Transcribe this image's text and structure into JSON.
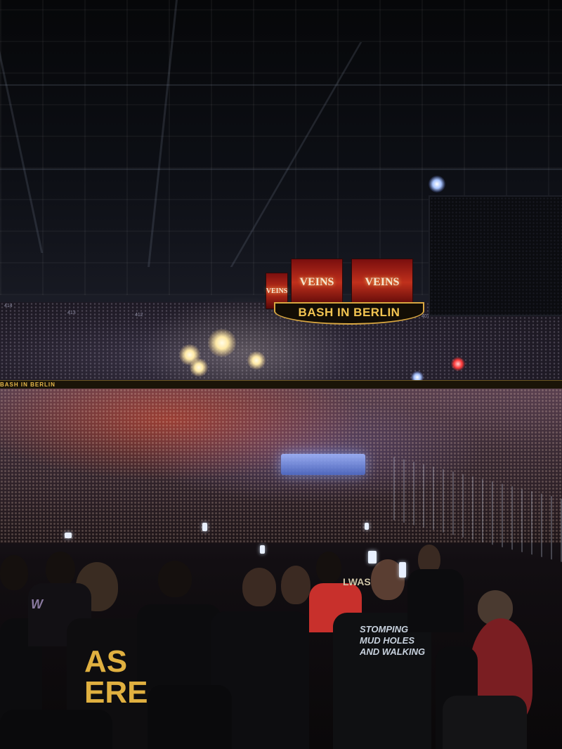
{
  "scene": {
    "description_colors": {
      "arena_dark": "#07070a",
      "stage_gold": "#f2c451",
      "crowd_red": "#dc4628",
      "screen_red": "#c0301c"
    },
    "jumbotron": {
      "screen_left": "VEINS",
      "screen_middle": "VEINS",
      "screen_right": "VEINS",
      "ring_text": "BASH IN BERLIN"
    },
    "ribbon_board_text": "BASH IN BERLIN",
    "section_numbers": [
      "414",
      "413",
      "412",
      "407"
    ],
    "shirts": {
      "left_shirt": "AS\nERE",
      "center_shirt": "STOMPING\nMUD HOLES\nAND WALKING",
      "right_shirt_small": "LWAS",
      "wwe_logo": "W"
    }
  }
}
